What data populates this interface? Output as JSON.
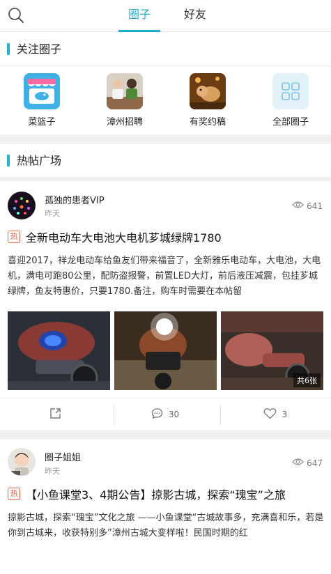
{
  "header": {
    "tabs": [
      {
        "label": "圈子",
        "active": true
      },
      {
        "label": "好友",
        "active": false
      }
    ],
    "search_icon": "search-icon",
    "accent_color": "#1eaad0"
  },
  "followed": {
    "title": "关注圈子",
    "items": [
      {
        "label": "菜篮子",
        "icon": "basket-icon"
      },
      {
        "label": "漳州招聘",
        "icon": "recruitment-photo"
      },
      {
        "label": "有奖约稿",
        "icon": "prize-photo"
      },
      {
        "label": "全部圈子",
        "icon": "grid-icon"
      }
    ]
  },
  "hot": {
    "title": "热帖广场",
    "hot_badge": "热",
    "posts": [
      {
        "user": "孤独的患者VIP",
        "time": "昨天",
        "views": "641",
        "title": "全新电动车大电池大电机芗城绿牌1780",
        "body": "喜迎2017，祥龙电动车给鱼友们带来福音了，全新雅乐电动车，大电池，大电机，满电可跑80公里，配防盗报警，前置LED大灯，前后液压减震，包挂芗城绿牌，鱼友特惠价，只要1780.备注，购车时需要在本帖留",
        "photo_count": "共6张",
        "comments": "30",
        "likes": "3"
      },
      {
        "user": "圈子姐姐",
        "time": "昨天",
        "views": "647",
        "title": "【小鱼课堂3、4期公告】掠影古城，探索“瑰宝”之旅",
        "body": "掠影古城，探索“瑰宝”文化之旅 ——小鱼课堂“古城故事多，充满喜和乐，若是你到古城来，收获特别多”漳州古城大变样啦！民国时期的红"
      }
    ]
  }
}
